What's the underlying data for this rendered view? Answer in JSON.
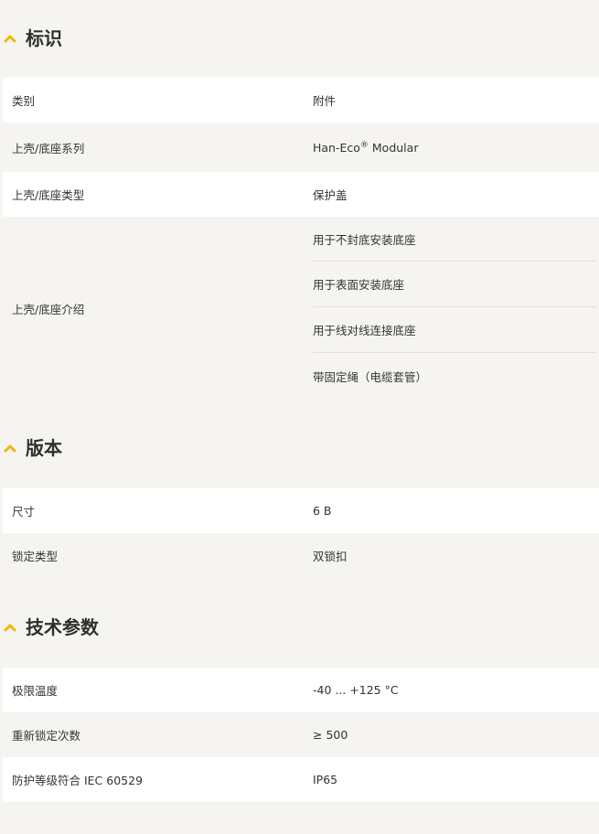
{
  "colors": {
    "accent": "#f2b705",
    "row_white": "#ffffff",
    "row_grey": "#f5f4f1",
    "text": "#333333"
  },
  "sections": [
    {
      "title": "标识",
      "icon": "chevron-up-icon",
      "rows": [
        {
          "label": "类别",
          "value": "附件"
        },
        {
          "label": "上壳/底座系列",
          "value_main": "Han-Eco",
          "value_sup": "®",
          "value_tail": " Modular"
        },
        {
          "label": "上壳/底座类型",
          "value": "保护盖"
        },
        {
          "label": "上壳/底座介绍",
          "values": [
            "用于不封底安装底座",
            "用于表面安装底座",
            "用于线对线连接底座",
            "带固定绳（电缆套管）"
          ]
        }
      ]
    },
    {
      "title": "版本",
      "icon": "chevron-up-icon",
      "rows": [
        {
          "label": "尺寸",
          "value": "6 B"
        },
        {
          "label": "锁定类型",
          "value": "双锁扣"
        }
      ]
    },
    {
      "title": "技术参数",
      "icon": "chevron-up-icon",
      "rows": [
        {
          "label": "极限温度",
          "value": "-40 ... +125 °C"
        },
        {
          "label": "重新锁定次数",
          "value": "≥ 500"
        },
        {
          "label": "防护等级符合 IEC 60529",
          "value": "IP65"
        }
      ]
    }
  ]
}
